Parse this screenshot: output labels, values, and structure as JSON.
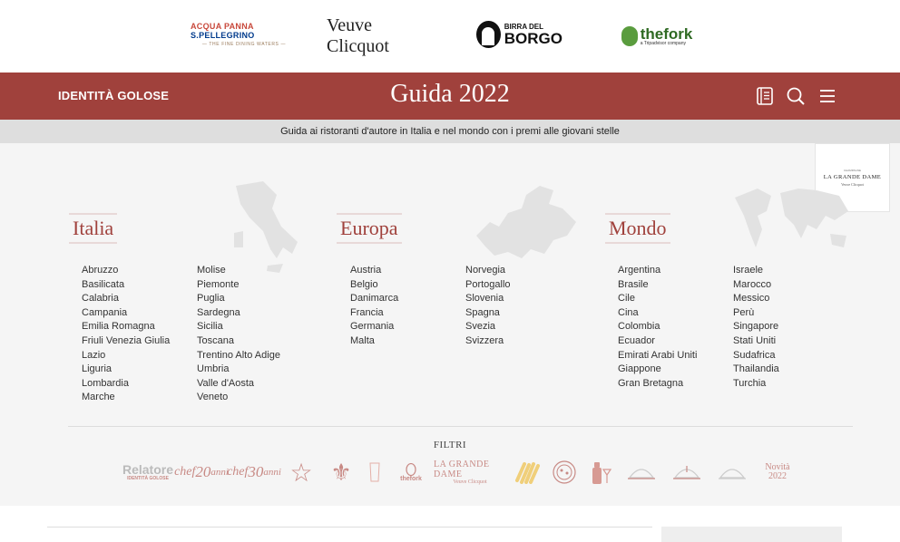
{
  "sponsors": {
    "acqua_panna": "ACQUA PANNA",
    "san_pellegrino": "S.PELLEGRINO",
    "fine_dining": "— THE FINE DINING WATERS —",
    "veuve_clicquot": "Veuve Clicquot",
    "birra_del": "BIRRA DEL",
    "borgo": "BORGO",
    "thefork": "thefork",
    "thefork_sub": "a Tripadvisor company"
  },
  "header": {
    "brand": "IDENTITÀ GOLOSE",
    "title": "Guida 2022",
    "subtitle": "Guida ai ristoranti d'autore in Italia e nel mondo con i premi alle giovani stelle"
  },
  "ad": {
    "top": "CHAMPAGNE",
    "name": "LA GRANDE DAME",
    "sub": "Veuve Clicquot"
  },
  "sections": {
    "italia": {
      "title": "Italia",
      "col1": [
        "Abruzzo",
        "Basilicata",
        "Calabria",
        "Campania",
        "Emilia Romagna",
        "Friuli Venezia Giulia",
        "Lazio",
        "Liguria",
        "Lombardia",
        "Marche"
      ],
      "col2": [
        "Molise",
        "Piemonte",
        "Puglia",
        "Sardegna",
        "Sicilia",
        "Toscana",
        "Trentino Alto Adige",
        "Umbria",
        "Valle d'Aosta",
        "Veneto"
      ]
    },
    "europa": {
      "title": "Europa",
      "col1": [
        "Austria",
        "Belgio",
        "Danimarca",
        "Francia",
        "Germania",
        "Malta"
      ],
      "col2": [
        "Norvegia",
        "Portogallo",
        "Slovenia",
        "Spagna",
        "Svezia",
        "Svizzera"
      ]
    },
    "mondo": {
      "title": "Mondo",
      "col1": [
        "Argentina",
        "Brasile",
        "Cile",
        "Cina",
        "Colombia",
        "Ecuador",
        "Emirati Arabi Uniti",
        "Giappone",
        "Gran Bretagna"
      ],
      "col2": [
        "Israele",
        "Marocco",
        "Messico",
        "Perù",
        "Singapore",
        "Stati Uniti",
        "Sudafrica",
        "Thailandia",
        "Turchia"
      ]
    }
  },
  "filters": {
    "label": "FILTRI",
    "relatore": "Relatore",
    "relatore_sub": "IDENTITÀ GOLOSE",
    "chef20": "chef",
    "chef20_num": "20",
    "chef20_anni": "anni",
    "chef30": "chef",
    "chef30_num": "30",
    "chef30_anni": "anni",
    "thefork": "thefork",
    "grande_dame": "LA GRANDE DAME",
    "grande_dame_sub": "Veuve Clicquot",
    "novita": "Novità",
    "novita_year": "2022"
  },
  "colors": {
    "accent": "#a0413c",
    "filter_icon": "#c88a85"
  }
}
